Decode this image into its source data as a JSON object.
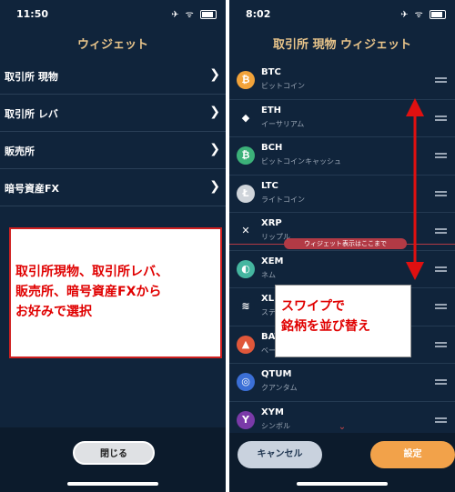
{
  "left": {
    "status": {
      "time": "11:50",
      "icons": "✈ ᯤ"
    },
    "title": "ウィジェット",
    "menu": [
      {
        "label": "取引所 現物"
      },
      {
        "label": "取引所 レバ"
      },
      {
        "label": "販売所"
      },
      {
        "label": "暗号資産FX"
      }
    ],
    "callout": "取引所現物、取引所レバ、\n販売所、暗号資産FXから\nお好みで選択",
    "close_label": "閉じる"
  },
  "right": {
    "status": {
      "time": "8:02",
      "icons": "✈ ᯤ"
    },
    "title": "取引所 現物 ウィジェット",
    "coins": [
      {
        "symbol": "BTC",
        "name": "ビットコイン",
        "glyph": "₿",
        "color": "#f2a33a",
        "icon": "btc-icon"
      },
      {
        "symbol": "ETH",
        "name": "イーサリアム",
        "glyph": "◆",
        "color": "#10243b",
        "icon": "eth-icon"
      },
      {
        "symbol": "BCH",
        "name": "ビットコインキャッシュ",
        "glyph": "₿",
        "color": "#3cb179",
        "icon": "bch-icon"
      },
      {
        "symbol": "LTC",
        "name": "ライトコイン",
        "glyph": "Ł",
        "color": "#cfd4da",
        "icon": "ltc-icon"
      },
      {
        "symbol": "XRP",
        "name": "リップル",
        "glyph": "✕",
        "color": "#10243b",
        "icon": "xrp-icon"
      },
      {
        "symbol": "XEM",
        "name": "ネム",
        "glyph": "◐",
        "color": "#45b6a0",
        "icon": "xem-icon"
      },
      {
        "symbol": "XLM",
        "name": "ステ",
        "glyph": "≋",
        "color": "#10243b",
        "icon": "xlm-icon"
      },
      {
        "symbol": "BAT",
        "name": "ベー",
        "glyph": "▲",
        "color": "#e0573a",
        "icon": "bat-icon"
      },
      {
        "symbol": "QTUM",
        "name": "クアンタム",
        "glyph": "◎",
        "color": "#3b6fd6",
        "icon": "qtum-icon"
      },
      {
        "symbol": "XYM",
        "name": "シンボル",
        "glyph": "Y",
        "color": "#7a3aa8",
        "icon": "xym-icon"
      }
    ],
    "widget_limit": "ウィジェット表示はここまで",
    "callout": "スワイプで\n銘柄を並び替え",
    "cancel_label": "キャンセル",
    "settings_label": "設定"
  },
  "colors": {
    "accent": "#e8c48a",
    "background": "#10243b",
    "arrow": "#e01010",
    "settings": "#f2a24a"
  }
}
